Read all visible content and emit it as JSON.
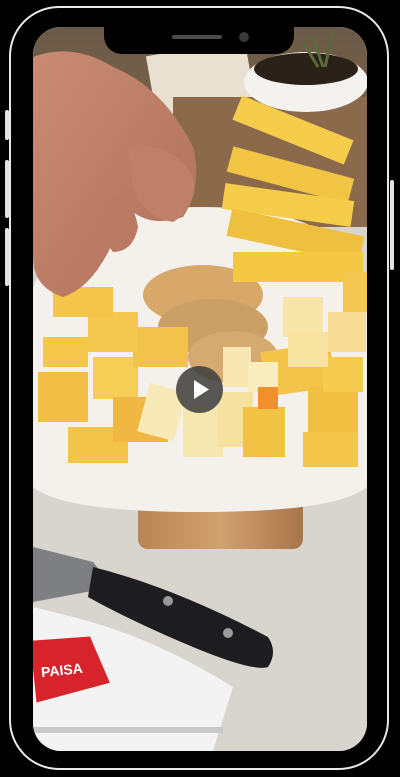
{
  "video": {
    "brand_text": "PAISA",
    "play_icon": "play-icon"
  },
  "colors": {
    "frame": "#e9e9e9",
    "cheese": "#f2c443",
    "plate": "#f4f1ec",
    "counter": "#d8d4ce",
    "brand_red": "#d6232c"
  }
}
